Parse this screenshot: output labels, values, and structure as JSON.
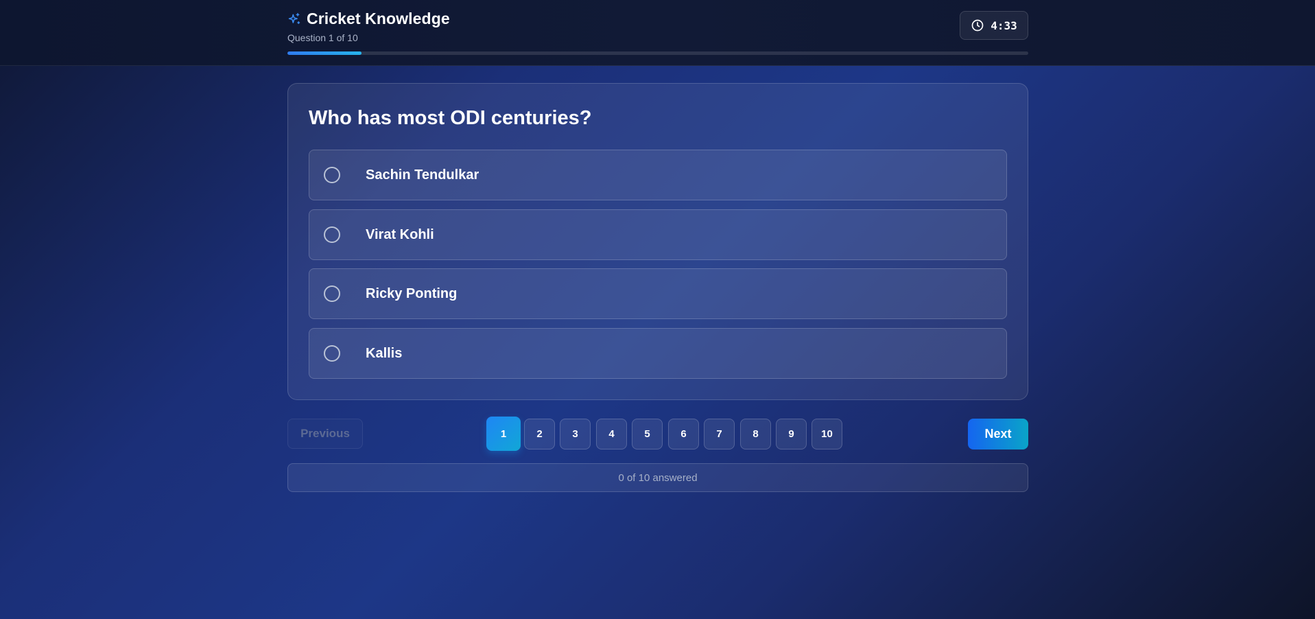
{
  "header": {
    "title": "Cricket Knowledge",
    "question_counter": "Question 1 of 10",
    "timer": "4:33",
    "progress_fraction": 0.1
  },
  "question": {
    "text": "Who has most ODI centuries?",
    "options": [
      {
        "label": "Sachin Tendulkar"
      },
      {
        "label": "Virat Kohli"
      },
      {
        "label": "Ricky Ponting"
      },
      {
        "label": "Kallis"
      }
    ]
  },
  "navigation": {
    "previous_label": "Previous",
    "next_label": "Next",
    "pages": [
      "1",
      "2",
      "3",
      "4",
      "5",
      "6",
      "7",
      "8",
      "9",
      "10"
    ],
    "current_page": "1"
  },
  "footer": {
    "answered_status": "0 of 10 answered"
  },
  "icons": {
    "title_icon": "sparkles-icon",
    "timer_icon": "clock-icon",
    "option_icon": "radio-unchecked-icon"
  },
  "colors": {
    "accent": "#1f86f5",
    "accent_secondary": "#0aa4c8",
    "text_muted": "#aab3c8"
  }
}
